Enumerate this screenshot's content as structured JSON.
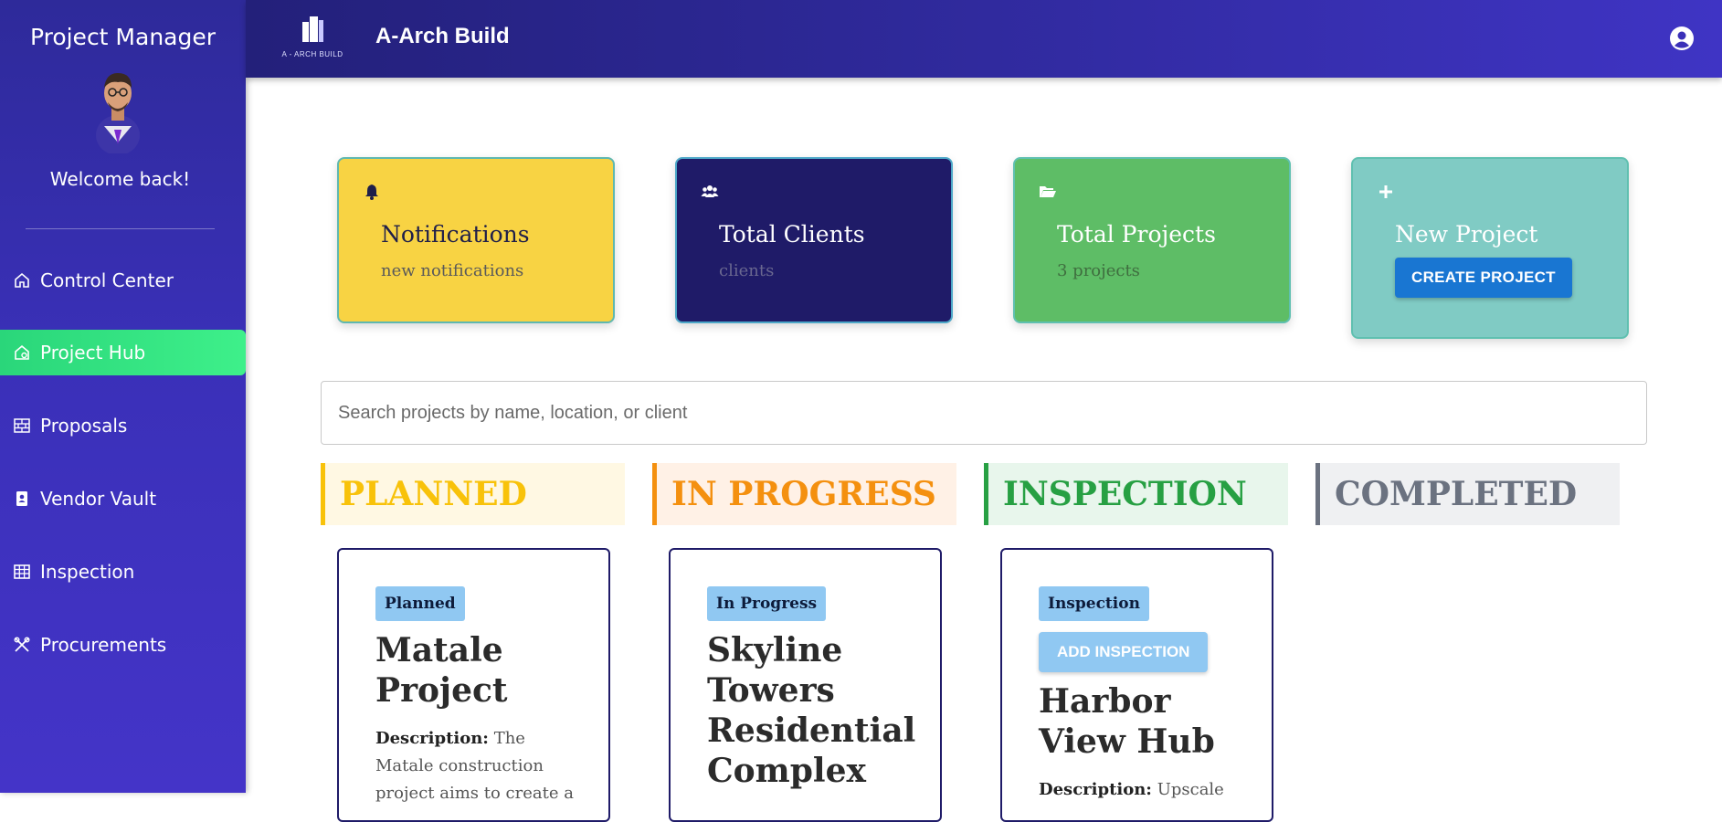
{
  "sidebar": {
    "title": "Project Manager",
    "welcome": "Welcome back!",
    "items": [
      {
        "label": "Control Center",
        "icon": "home-icon"
      },
      {
        "label": "Project Hub",
        "icon": "home-gear-icon"
      },
      {
        "label": "Proposals",
        "icon": "brick-icon"
      },
      {
        "label": "Vendor Vault",
        "icon": "badge-icon"
      },
      {
        "label": "Inspection",
        "icon": "table-icon"
      },
      {
        "label": "Procurements",
        "icon": "tools-icon"
      }
    ],
    "active_color": "#2ad67a"
  },
  "header": {
    "brand": "A-Arch Build",
    "logo_text": "A - ARCH BUILD"
  },
  "stats": {
    "notifications": {
      "title": "Notifications",
      "sub": "new notifications"
    },
    "clients": {
      "title": "Total Clients",
      "sub": "clients"
    },
    "projects": {
      "title": "Total Projects",
      "sub": "3 projects"
    },
    "new_project": {
      "title": "New Project",
      "button": "CREATE PROJECT"
    }
  },
  "search": {
    "placeholder": "Search projects by name, location, or client"
  },
  "columns": {
    "planned": "PLANNED",
    "in_progress": "IN PROGRESS",
    "inspection": "INSPECTION",
    "completed": "COMPLETED"
  },
  "projects": [
    {
      "status": "Planned",
      "name": "Matale Project",
      "desc_label": "Description:",
      "desc": "The Matale construction project aims to create a"
    },
    {
      "status": "In Progress",
      "name": "Skyline Towers Residential Complex",
      "desc_label": "",
      "desc": ""
    },
    {
      "status": "Inspection",
      "action": "ADD INSPECTION",
      "name": "Harbor View Hub",
      "desc_label": "Description:",
      "desc": "Upscale"
    }
  ],
  "colors": {
    "planned": "#f8c20a",
    "in_progress": "#f4900f",
    "inspection": "#27a043",
    "completed": "#6b7280",
    "primary": "#1976d2"
  }
}
